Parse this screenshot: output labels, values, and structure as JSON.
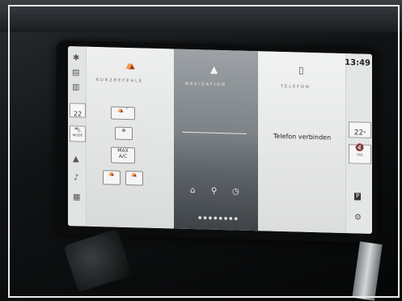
{
  "left_sidebar": {
    "temp": "22",
    "temp_unit": "°",
    "mode_label": "MODE"
  },
  "kurzbefehle": {
    "title": "KURZBEFEHLE",
    "max_ac_line1": "MAX",
    "max_ac_line2": "A/C"
  },
  "navigation": {
    "title": "NAVIGATION"
  },
  "telefon": {
    "title": "TELEFON",
    "connect_label": "Telefon verbinden"
  },
  "right_sidebar": {
    "clock": "13:49",
    "temp": "22",
    "temp_unit": "°",
    "vol_label": "VOL"
  },
  "icons": [
    "car-icon",
    "seat-icon",
    "navigation-arrow-icon",
    "phone-icon",
    "music-icon",
    "apps-icon",
    "home-icon",
    "search-icon",
    "history-icon",
    "mute-icon",
    "settings-icon",
    "parking-icon"
  ]
}
